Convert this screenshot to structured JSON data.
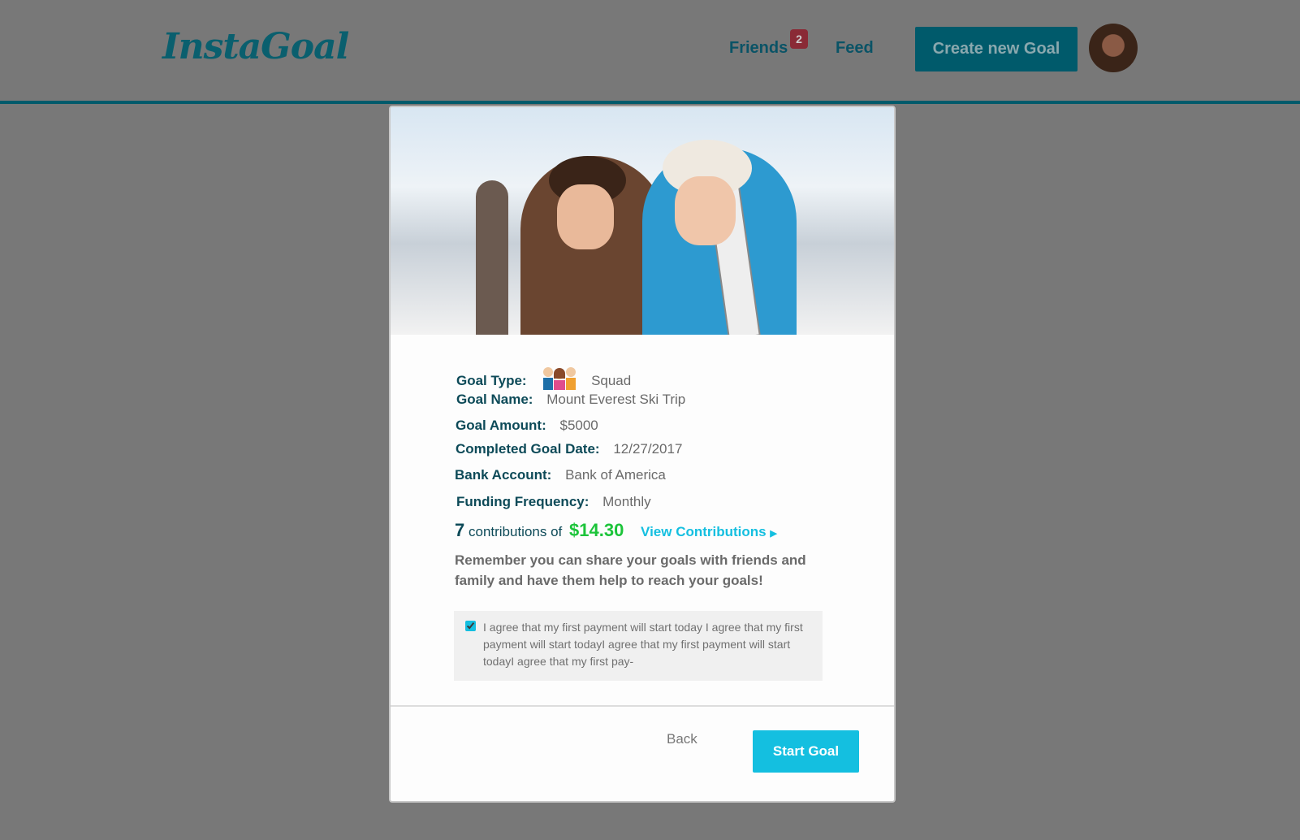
{
  "header": {
    "logo": "InstaGoal",
    "nav": {
      "friends": "Friends",
      "friends_badge": "2",
      "feed": "Feed"
    },
    "create_button": "Create new Goal"
  },
  "goal": {
    "type_label": "Goal Type:",
    "type_value": "Squad",
    "name_label": "Goal Name:",
    "name_value": "Mount Everest Ski Trip",
    "amount_label": "Goal Amount:",
    "amount_value": "$5000",
    "date_label": "Completed Goal Date:",
    "date_value": "12/27/2017",
    "bank_label": "Bank Account:",
    "bank_value": "Bank of America",
    "freq_label": "Funding Frequency:",
    "freq_value": "Monthly"
  },
  "contributions": {
    "count": "7",
    "text": "contributions of",
    "amount": "$14.30",
    "link": "View Contributions"
  },
  "reminder": "Remember you can share your goals with friends and family and have them help to reach your goals!",
  "agreement": {
    "checked": true,
    "text": "I agree that my first payment will start today I agree that my first payment will start todayI agree that my first payment will start todayI agree that my first pay-"
  },
  "actions": {
    "back": "Back",
    "start": "Start Goal"
  },
  "colors": {
    "brand": "#005a6b",
    "accent": "#14bfe0",
    "amount": "#1cc43a",
    "badge": "#8a2a36"
  }
}
